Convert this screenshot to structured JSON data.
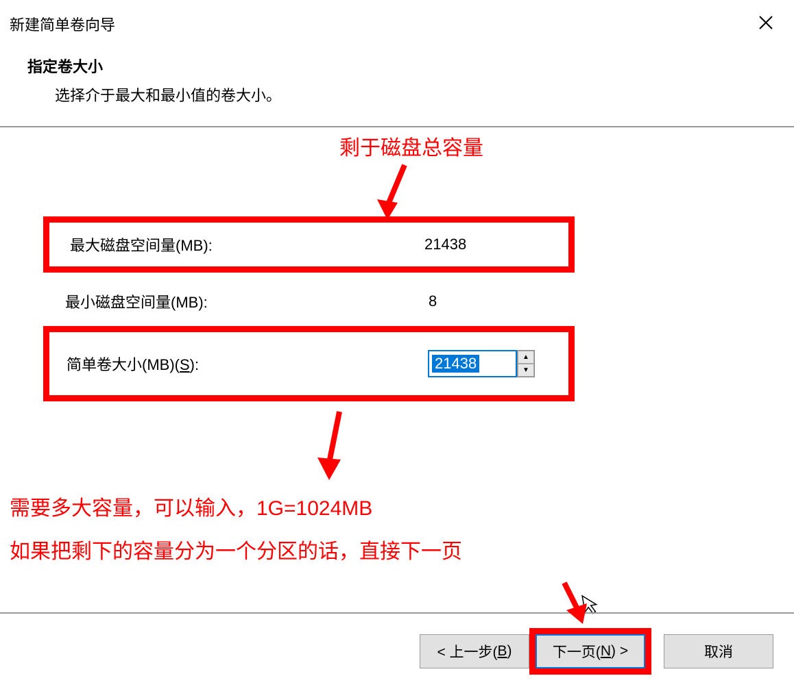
{
  "window": {
    "title": "新建简单卷向导"
  },
  "header": {
    "title": "指定卷大小",
    "subtitle": "选择介于最大和最小值的卷大小。"
  },
  "annotations": {
    "top": "剩于磁盘总容量",
    "bottom_line1": "需要多大容量，可以输入，1G=1024MB",
    "bottom_line2": "如果把剩下的容量分为一个分区的话，直接下一页"
  },
  "fields": {
    "max_label": "最大磁盘空间量(MB):",
    "max_value": "21438",
    "min_label": "最小磁盘空间量(MB):",
    "min_value": "8",
    "size_label_prefix": "简单卷大小(MB)(",
    "size_label_key": "S",
    "size_label_suffix": "):",
    "size_value": "21438"
  },
  "buttons": {
    "back_prefix": "< 上一步(",
    "back_key": "B",
    "back_suffix": ")",
    "next_prefix": "下一页(",
    "next_key": "N",
    "next_suffix": ") >",
    "cancel": "取消"
  },
  "spinner": {
    "up": "▲",
    "down": "▼"
  }
}
